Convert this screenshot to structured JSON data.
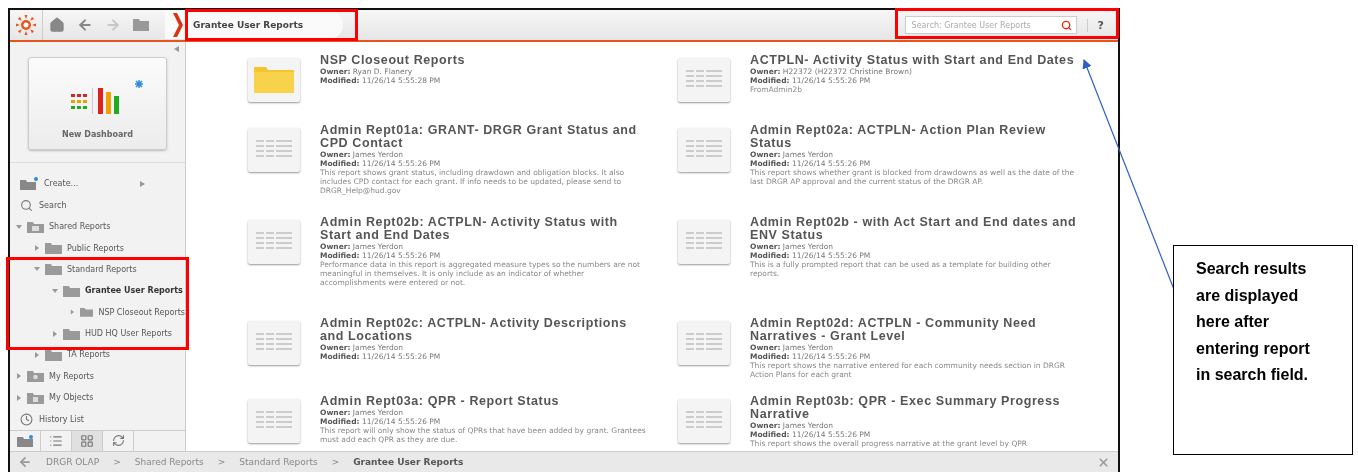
{
  "toolbar": {
    "breadcrumb_tab": "Grantee User Reports",
    "search": {
      "placeholder": "Search: Grantee User Reports"
    },
    "help": "?"
  },
  "sidebar": {
    "tile": {
      "label": "New Dashboard"
    },
    "actions": [
      {
        "label": "Create...",
        "kind": "create"
      },
      {
        "label": "Search",
        "kind": "search"
      }
    ],
    "tree": [
      {
        "label": "Shared Reports",
        "kind": "shared",
        "expanded": true,
        "selected": false,
        "children": [
          {
            "label": "Public Reports",
            "kind": "folder",
            "expanded": false,
            "selected": false
          },
          {
            "label": "Standard Reports",
            "kind": "folder",
            "expanded": true,
            "selected": false,
            "children": [
              {
                "label": "Grantee User Reports",
                "kind": "folder",
                "expanded": true,
                "selected": true,
                "children": [
                  {
                    "label": "NSP Closeout Reports",
                    "kind": "folder",
                    "expanded": false,
                    "selected": false
                  }
                ]
              },
              {
                "label": "HUD HQ User Reports",
                "kind": "folder",
                "expanded": false,
                "selected": false
              }
            ]
          },
          {
            "label": "TA Reports",
            "kind": "folder",
            "expanded": false,
            "selected": false
          }
        ]
      },
      {
        "label": "My Reports",
        "kind": "personal",
        "expanded": false,
        "selected": false
      },
      {
        "label": "My Objects",
        "kind": "objects",
        "expanded": false,
        "selected": false
      }
    ],
    "history": "History List"
  },
  "reports": [
    {
      "kind": "folder",
      "title": "NSP Closeout Reports",
      "owner": "**Owner:** Ryan D. Flanery",
      "modified": "**Modified:** 11/26/14 5:55:28 PM"
    },
    {
      "kind": "report",
      "title": "ACTPLN- Activity Status with Start and End Dates",
      "owner": "**Owner:** H22372 (H22372 Christine Brown)",
      "modified": "**Modified:** 11/26/14 5:55:26 PM",
      "description": "FromAdmin2b"
    },
    {
      "kind": "report",
      "title": "Admin Rept01a: GRANT- DRGR Grant Status and CPD Contact",
      "owner": "**Owner:** James Yerdon",
      "modified": "**Modified:** 11/26/14 5:55:26 PM",
      "description": "This report shows grant status, including drawdown and obligation blocks.  It also includes CPD contact for each grant. If info needs to be updated, please send to DRGR_Help@hud.gov"
    },
    {
      "kind": "report",
      "title": "Admin Rept02a: ACTPLN- Action Plan Review Status",
      "owner": "**Owner:** James Yerdon",
      "modified": "**Modified:** 11/26/14 5:55:26 PM",
      "description": "This report shows whether grant is blocked from drawdowns as well as the date of the last DRGR AP approval and the current status of the DRGR AP."
    },
    {
      "kind": "report",
      "title": "Admin Rept02b: ACTPLN- Activity Status with Start and End Dates",
      "owner": "**Owner:** James Yerdon",
      "modified": "**Modified:** 11/26/14 5:55:26 PM",
      "description": "Performance data in this report is aggregated measure types so the numbers are not meaningful in themselves.  It is only include as an indicator of whether accomplishments were entered or not."
    },
    {
      "kind": "report",
      "title": "Admin Rept02b - with Act Start and End dates and ENV Status",
      "owner": "**Owner:** James Yerdon",
      "modified": "**Modified:** 11/26/14 5:55:26 PM",
      "description": "This is a fully prompted report that can be used as a template for building other reports."
    },
    {
      "kind": "report",
      "title": "Admin Rept02c: ACTPLN- Activity Descriptions and Locations",
      "owner": "**Owner:** James Yerdon",
      "modified": "**Modified:** 11/26/14 5:55:26 PM"
    },
    {
      "kind": "report",
      "title": "Admin Rept02d: ACTPLN - Community Need Narratives - Grant Level",
      "owner": "**Owner:** James Yerdon",
      "modified": "**Modified:** 11/26/14 5:55:26 PM",
      "description": "This report shows the narrative entered for each community needs section in DRGR Action Plans for each grant"
    },
    {
      "kind": "report",
      "title": "Admin Rept03a: QPR - Report Status",
      "owner": "**Owner:** James Yerdon",
      "modified": "**Modified:** 11/26/14 5:55:26 PM",
      "description": "This report will only show the status of QPRs that have been added by grant. Grantees must add each QPR as they are due."
    },
    {
      "kind": "report",
      "title": "Admin Rept03b: QPR - Exec Summary Progress Narrative",
      "owner": "**Owner:** James Yerdon",
      "modified": "**Modified:** 11/26/14 5:55:26 PM",
      "description": "This report shows the overall progress narrative at the grant level by QPR"
    }
  ],
  "path": [
    {
      "label": "DRGR OLAP",
      "kind": "link"
    },
    {
      "label": ">",
      "kind": "separator"
    },
    {
      "label": "Shared Reports",
      "kind": "link"
    },
    {
      "label": ">",
      "kind": "separator"
    },
    {
      "label": "Standard Reports",
      "kind": "link"
    },
    {
      "label": ">",
      "kind": "separator"
    },
    {
      "label": "Grantee User Reports",
      "kind": "current"
    }
  ],
  "callout": "Search results are displayed here after entering report in search field."
}
